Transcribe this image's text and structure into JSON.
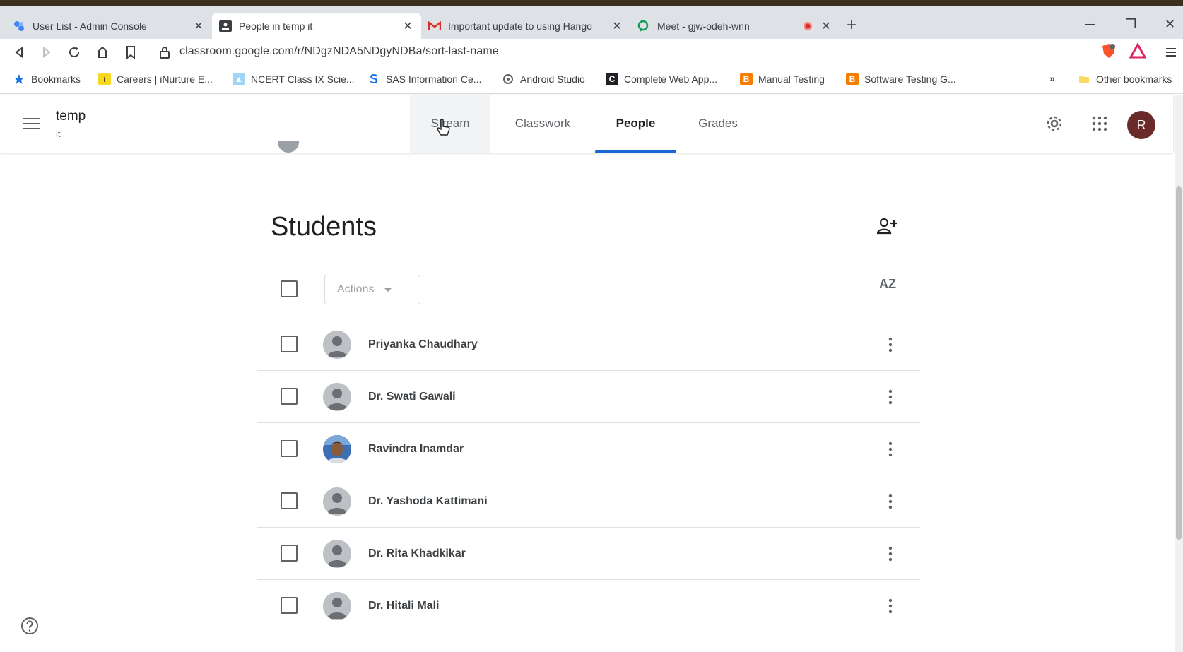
{
  "browser": {
    "tabs": [
      {
        "title": "User List - Admin Console",
        "icon": "admin-console-icon"
      },
      {
        "title": "People in temp it",
        "icon": "classroom-icon"
      },
      {
        "title": "Important update to using Hango",
        "icon": "gmail-icon"
      },
      {
        "title": "Meet - gjw-odeh-wnn",
        "icon": "meet-icon"
      }
    ],
    "url": "classroom.google.com/r/NDgzNDA5NDgyNDBa/sort-last-name",
    "bookmarks": [
      {
        "label": "Bookmarks",
        "icon": "star-icon"
      },
      {
        "label": "Careers | iNurture E...",
        "icon": "inurture-icon"
      },
      {
        "label": "NCERT Class IX Scie...",
        "icon": "ncert-icon"
      },
      {
        "label": "SAS Information Ce...",
        "icon": "sas-icon"
      },
      {
        "label": "Android Studio",
        "icon": "android-studio-icon"
      },
      {
        "label": "Complete Web App...",
        "icon": "web-app-icon"
      },
      {
        "label": "Manual Testing",
        "icon": "blogger-icon"
      },
      {
        "label": "Software Testing G...",
        "icon": "blogger-icon"
      }
    ],
    "other_bookmarks": "Other bookmarks",
    "overflow": "»"
  },
  "header": {
    "class_name": "temp",
    "class_section": "it",
    "nav": [
      "Stream",
      "Classwork",
      "People",
      "Grades"
    ],
    "active_nav": "People",
    "avatar_letter": "R"
  },
  "students": {
    "title": "Students",
    "actions_label": "Actions",
    "sort_label": "AZ",
    "list": [
      {
        "name": "Priyanka Chaudhary"
      },
      {
        "name": "Dr. Swati Gawali"
      },
      {
        "name": "Ravindra Inamdar"
      },
      {
        "name": "Dr. Yashoda Kattimani"
      },
      {
        "name": "Dr. Rita Khadkikar"
      },
      {
        "name": "Dr. Hitali Mali"
      }
    ]
  },
  "colors": {
    "accent": "#1967d2",
    "avatar_bg": "#6b2a2a"
  }
}
